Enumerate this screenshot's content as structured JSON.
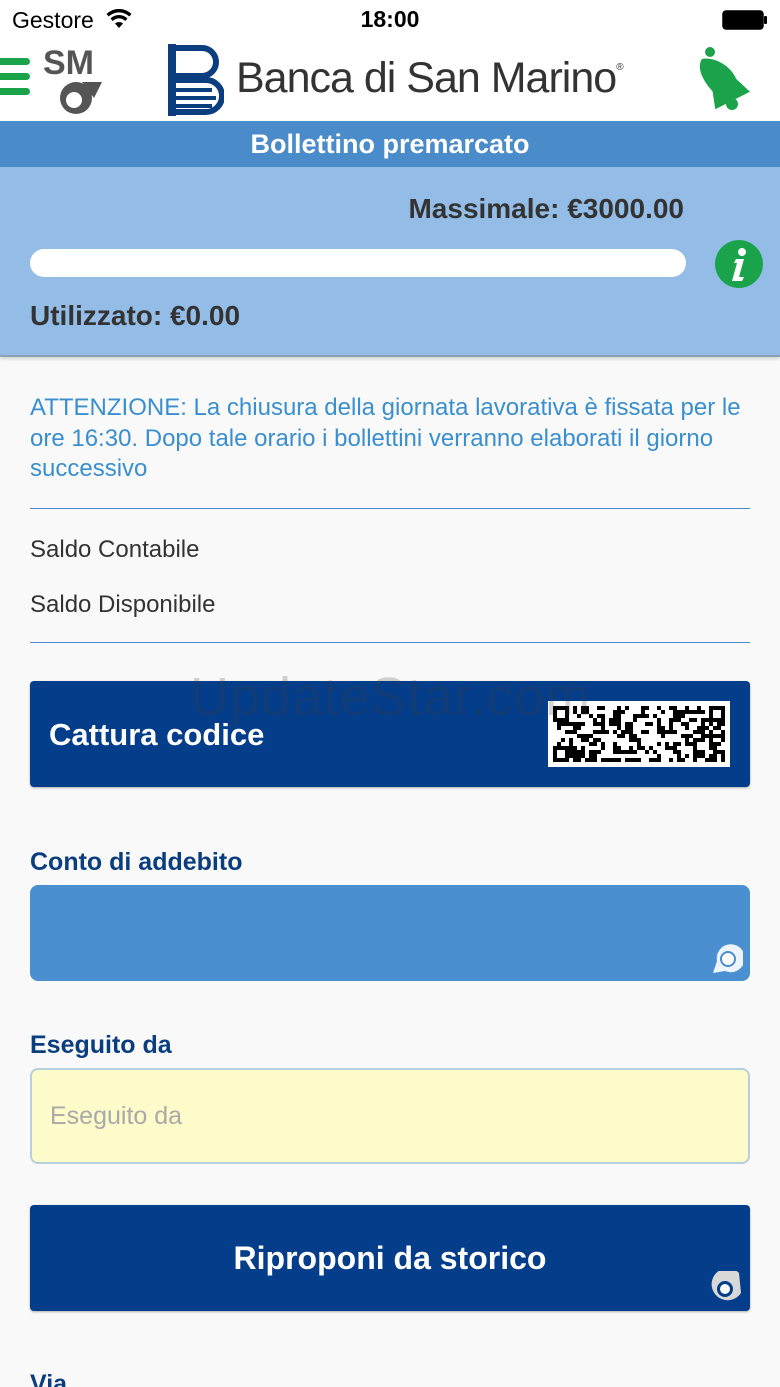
{
  "status_bar": {
    "carrier": "Gestore",
    "time": "18:00"
  },
  "header": {
    "logo_text": "SM",
    "bank_name": "Banca di San Marino",
    "bank_name_mark": "®",
    "accent_color": "#1aa34a"
  },
  "title_bar": {
    "title": "Bollettino premarcato"
  },
  "limit_panel": {
    "massimale": "Massimale: €3000.00",
    "utilizzato": "Utilizzato: €0.00",
    "usage_fraction": 0.0
  },
  "notice": {
    "text": "ATTENZIONE: La chiusura della giornata lavorativa è fissata per le ore 16:30. Dopo tale orario i bollettini verranno elaborati il giorno successivo"
  },
  "balances": {
    "saldo_contabile": "Saldo Contabile",
    "saldo_disponibile": "Saldo Disponibile"
  },
  "capture_button": {
    "label": "Cattura codice"
  },
  "form": {
    "account_label": "Conto di addebito",
    "account_value": "",
    "executed_by_label": "Eseguito da",
    "executed_by_placeholder": "Eseguito da",
    "executed_by_value": "",
    "street_label": "Via"
  },
  "history_button": {
    "label": "Riproponi da storico"
  },
  "watermark": "UpdateStar.com",
  "icons": {
    "wifi": "wifi-icon",
    "battery": "battery-icon",
    "menu": "hamburger-menu-icon",
    "bell": "bell-icon",
    "info": "info-icon",
    "qr": "qr-code-icon",
    "select": "picker-icon",
    "history": "history-icon"
  }
}
